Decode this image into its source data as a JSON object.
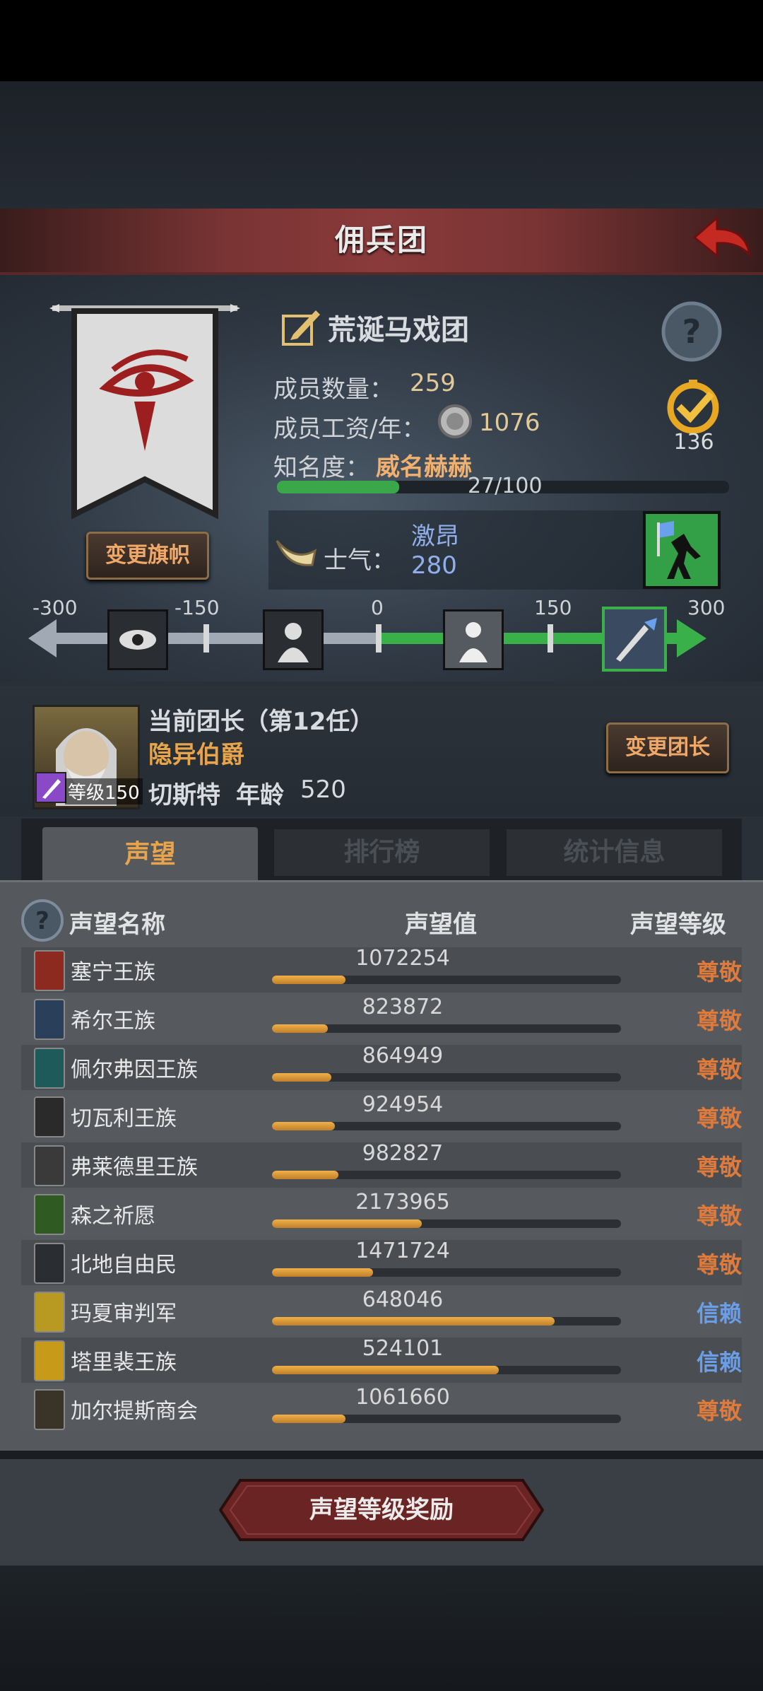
{
  "header": {
    "title": "佣兵团"
  },
  "guild": {
    "name": "荒诞马戏团",
    "members_label": "成员数量：",
    "members": "259",
    "wage_label": "成员工资/年：",
    "wage": "1076",
    "fame_label": "知名度：",
    "fame_value": "威名赫赫",
    "fame_progress_text": "27/100",
    "fame_progress": 0.27,
    "badge_count": "136",
    "change_banner_label": "变更旗帜"
  },
  "morale": {
    "label": "士气：",
    "state": "激昂",
    "value": "280",
    "value_numeric": 280,
    "scale_labels": [
      "-300",
      "-150",
      "0",
      "150",
      "300"
    ]
  },
  "leader": {
    "title": "当前团长（第12任）",
    "rank": "隐异伯爵",
    "name": "切斯特",
    "age_label": "年龄",
    "age": "520",
    "level_label": "等级150",
    "change_leader_label": "变更团长"
  },
  "tabs": [
    {
      "label": "声望"
    },
    {
      "label": "排行榜"
    },
    {
      "label": "统计信息"
    }
  ],
  "reputation": {
    "headers": {
      "name": "声望名称",
      "value": "声望值",
      "level": "声望等级"
    },
    "rows": [
      {
        "name": "塞宁王族",
        "value": "1072254",
        "fill": 0.21,
        "level": "尊敬",
        "color": "#e07a3a",
        "emblem_color": "#8c2a20"
      },
      {
        "name": "希尔王族",
        "value": "823872",
        "fill": 0.16,
        "level": "尊敬",
        "color": "#e07a3a",
        "emblem_color": "#2a3f5a"
      },
      {
        "name": "佩尔弗因王族",
        "value": "864949",
        "fill": 0.17,
        "level": "尊敬",
        "color": "#e07a3a",
        "emblem_color": "#1f5a5a"
      },
      {
        "name": "切瓦利王族",
        "value": "924954",
        "fill": 0.18,
        "level": "尊敬",
        "color": "#e07a3a",
        "emblem_color": "#2a2a2a"
      },
      {
        "name": "弗莱德里王族",
        "value": "982827",
        "fill": 0.19,
        "level": "尊敬",
        "color": "#e07a3a",
        "emblem_color": "#3a3a3a"
      },
      {
        "name": "森之祈愿",
        "value": "2173965",
        "fill": 0.43,
        "level": "尊敬",
        "color": "#e07a3a",
        "emblem_color": "#2f5a22"
      },
      {
        "name": "北地自由民",
        "value": "1471724",
        "fill": 0.29,
        "level": "尊敬",
        "color": "#e07a3a",
        "emblem_color": "#2a2e33"
      },
      {
        "name": "玛夏审判军",
        "value": "648046",
        "fill": 0.81,
        "level": "信赖",
        "color": "#6a9ee8",
        "emblem_color": "#b89a22"
      },
      {
        "name": "塔里裴王族",
        "value": "524101",
        "fill": 0.65,
        "level": "信赖",
        "color": "#6a9ee8",
        "emblem_color": "#c79a1a"
      },
      {
        "name": "加尔提斯商会",
        "value": "1061660",
        "fill": 0.21,
        "level": "尊敬",
        "color": "#e07a3a",
        "emblem_color": "#3a3328"
      }
    ]
  },
  "reward_button": {
    "label": "声望等级奖励"
  },
  "colors": {
    "accent_gold": "#e2c998",
    "respect_orange": "#e07a3a",
    "trust_blue": "#6a9ee8",
    "title_red": "#7a3434"
  }
}
